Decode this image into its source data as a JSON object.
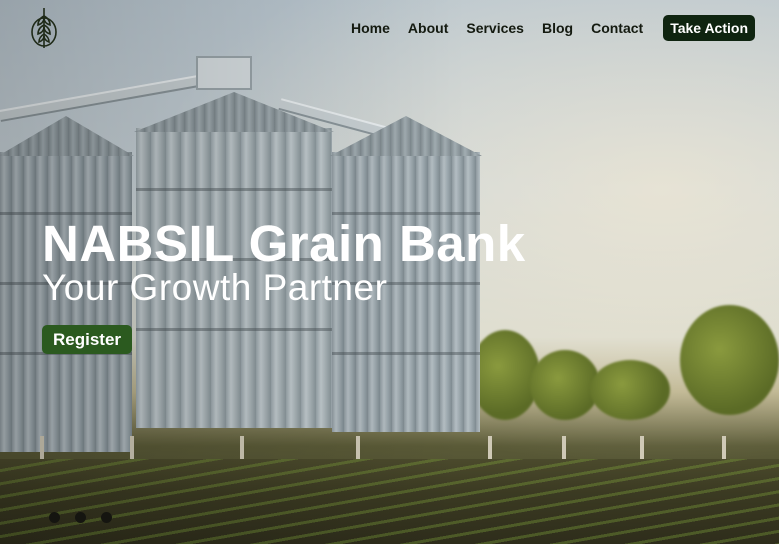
{
  "brand": {
    "logo_icon": "wheat-icon"
  },
  "nav": {
    "items": [
      "Home",
      "About",
      "Services",
      "Blog",
      "Contact"
    ],
    "cta_label": "Take Action"
  },
  "hero": {
    "title": "NABSIL Grain Bank",
    "subtitle": "Your Growth Partner",
    "button_label": "Register"
  },
  "carousel": {
    "slide_count": 3,
    "active_index": 0
  },
  "colors": {
    "cta_bg": "#0f2410",
    "button_bg": "#2b5a1f",
    "dot": "#151510",
    "text_light": "#ffffff"
  }
}
